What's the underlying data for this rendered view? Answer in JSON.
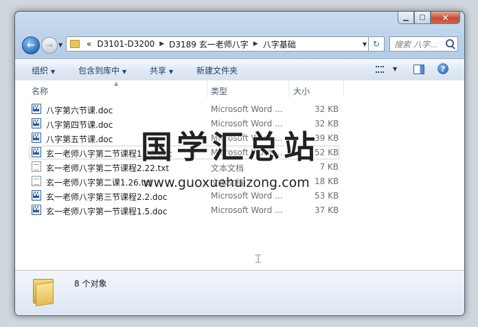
{
  "window": {
    "buttons": {
      "minimize": "▁",
      "maximize": "▢",
      "close": "✕"
    }
  },
  "nav": {
    "back_glyph": "←",
    "forward_glyph": "→",
    "breadcrumb_overflow": "«",
    "breadcrumbs": [
      "D3101-D3200",
      "D3189 玄一老师八字",
      "八字基础"
    ],
    "refresh_glyph": "↻"
  },
  "search": {
    "placeholder": "搜索 八字..."
  },
  "toolbar": {
    "organize": "组织",
    "include_in_library": "包含到库中",
    "share": "共享",
    "new_folder": "新建文件夹",
    "help": "?"
  },
  "columns": {
    "name": "名称",
    "type": "类型",
    "size": "大小"
  },
  "files": [
    {
      "name": "八字第六节课.doc",
      "type": "Microsoft Word ...",
      "size": "32 KB",
      "icon": "doc"
    },
    {
      "name": "八字第四节课.doc",
      "type": "Microsoft Word ...",
      "size": "32 KB",
      "icon": "doc"
    },
    {
      "name": "八字第五节课.doc",
      "type": "Microsoft Word ...",
      "size": "39 KB",
      "icon": "doc"
    },
    {
      "name": "玄一老师八字第二节课程1.26.doc",
      "type": "Microsoft Word ...",
      "size": "52 KB",
      "icon": "doc"
    },
    {
      "name": "玄一老师八字第二节课程2.22.txt",
      "type": "文本文档",
      "size": "7 KB",
      "icon": "txt"
    },
    {
      "name": "玄一老师八字第二课1.26.txt",
      "type": "文本文档",
      "size": "18 KB",
      "icon": "txt"
    },
    {
      "name": "玄一老师八字第三节课程2.2.doc",
      "type": "Microsoft Word ...",
      "size": "53 KB",
      "icon": "doc"
    },
    {
      "name": "玄一老师八字第一节课程1.5.doc",
      "type": "Microsoft Word ...",
      "size": "37 KB",
      "icon": "doc"
    }
  ],
  "watermark": {
    "title": "国学汇总站",
    "url": "www.guoxuehuizong.com"
  },
  "status": {
    "count": "8 个对象"
  }
}
